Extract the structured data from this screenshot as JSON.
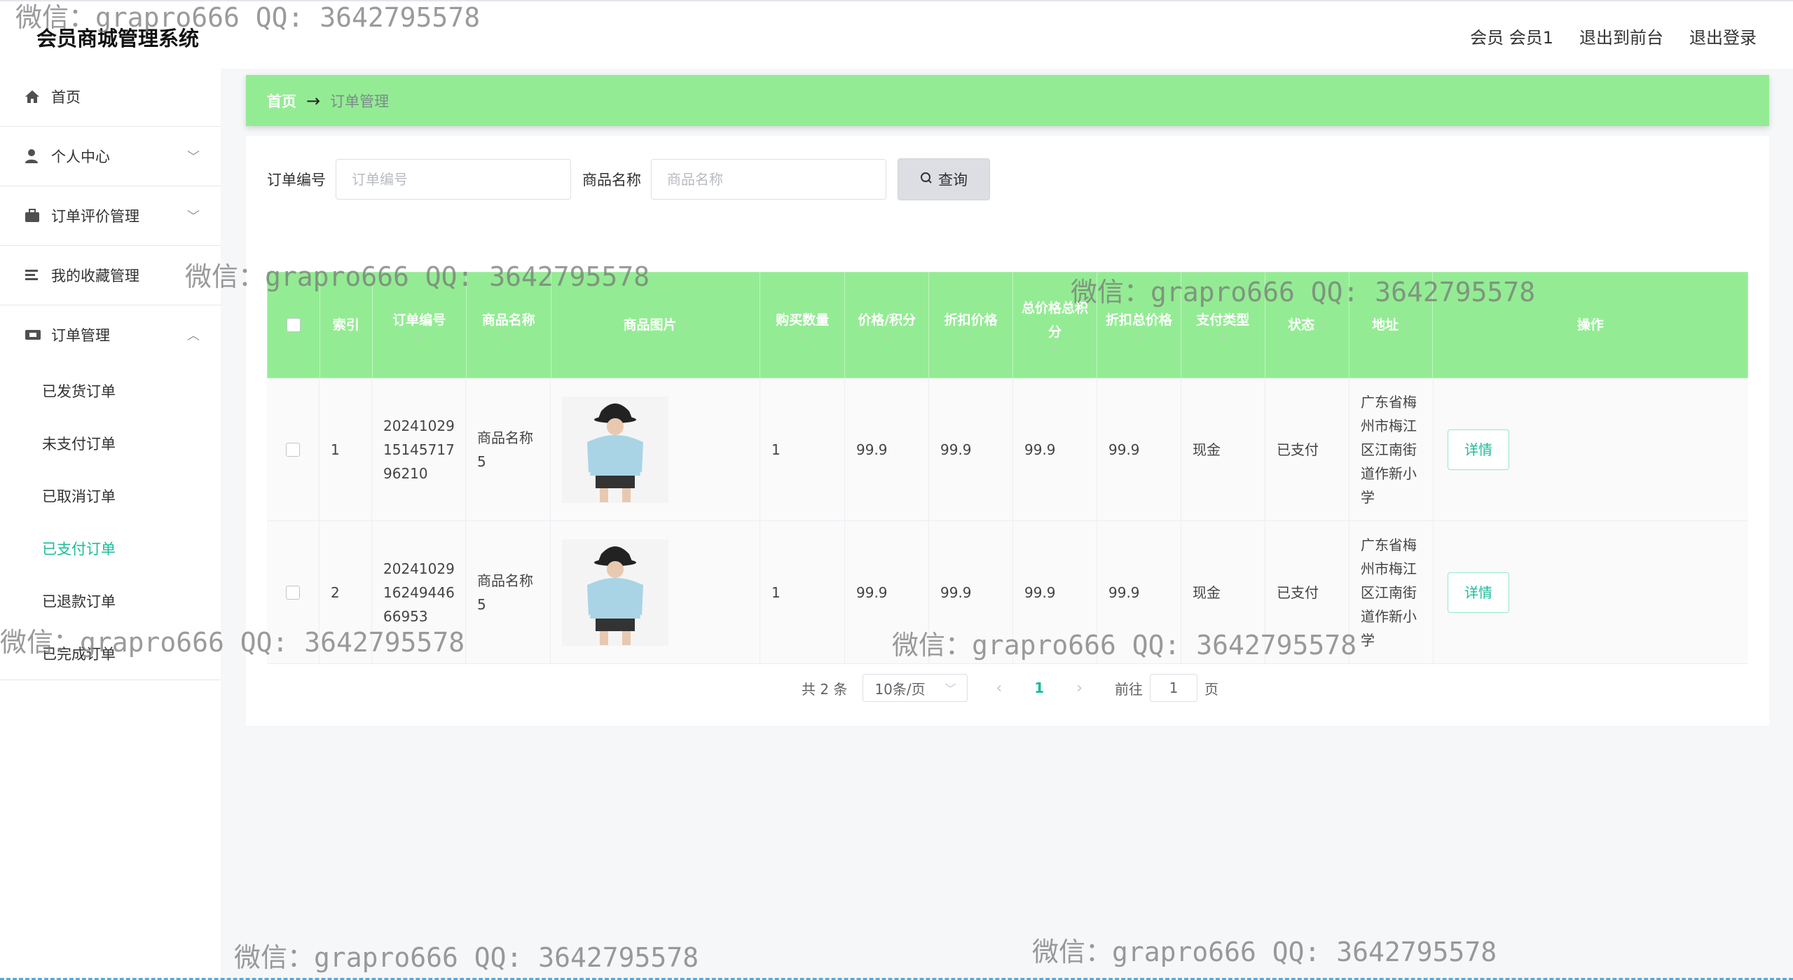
{
  "app_title": "会员商城管理系统",
  "top_links": [
    "会员 会员1",
    "退出到前台",
    "退出登录"
  ],
  "sidebar": {
    "items": [
      {
        "label": "首页"
      },
      {
        "label": "个人中心"
      },
      {
        "label": "订单评价管理"
      },
      {
        "label": "我的收藏管理"
      },
      {
        "label": "订单管理"
      }
    ],
    "sub_items": [
      {
        "label": "已发货订单"
      },
      {
        "label": "未支付订单"
      },
      {
        "label": "已取消订单"
      },
      {
        "label": "已支付订单"
      },
      {
        "label": "已退款订单"
      },
      {
        "label": "已完成订单"
      }
    ]
  },
  "breadcrumb": {
    "home": "首页",
    "arrow": "→",
    "current": "订单管理"
  },
  "search": {
    "order_label": "订单编号",
    "order_placeholder": "订单编号",
    "product_label": "商品名称",
    "product_placeholder": "商品名称",
    "button": "查询"
  },
  "table": {
    "headers": [
      "索引",
      "订单编号",
      "商品名称",
      "商品图片",
      "购买数量",
      "价格/积分",
      "折扣价格",
      "总价格总积分",
      "折扣总价格",
      "支付类型",
      "状态",
      "地址",
      "操作"
    ],
    "rows": [
      {
        "index": "1",
        "order_no": "20241029151457 1796210",
        "order_lines": [
          "20241029",
          "15145717",
          "96210"
        ],
        "product": "商品名称5",
        "product_lines": [
          "商品名称",
          "5"
        ],
        "qty": "1",
        "price": "99.9",
        "discount_price": "99.9",
        "total": "99.9",
        "discount_total": "99.9",
        "pay_type": "现金",
        "status": "已支付",
        "address_lines": [
          "广东省梅",
          "州市梅江",
          "区江南街",
          "道作新小",
          "学"
        ],
        "action": "详情"
      },
      {
        "index": "2",
        "order_no": "20241029162494 4666953",
        "order_lines": [
          "20241029",
          "16249446",
          "66953"
        ],
        "product": "商品名称5",
        "product_lines": [
          "商品名称",
          "5"
        ],
        "qty": "1",
        "price": "99.9",
        "discount_price": "99.9",
        "total": "99.9",
        "discount_total": "99.9",
        "pay_type": "现金",
        "status": "已支付",
        "address_lines": [
          "广东省梅",
          "州市梅江",
          "区江南街",
          "道作新小",
          "学"
        ],
        "action": "详情"
      }
    ]
  },
  "pagination": {
    "total": "共 2 条",
    "page_size": "10条/页",
    "current": "1",
    "goto": "前往",
    "goto_value": "1",
    "page_unit": "页"
  },
  "watermark": "微信：grapro666 QQ: 3642795578",
  "colors": {
    "accent": "#93ec93",
    "active": "#1bbc9b"
  }
}
